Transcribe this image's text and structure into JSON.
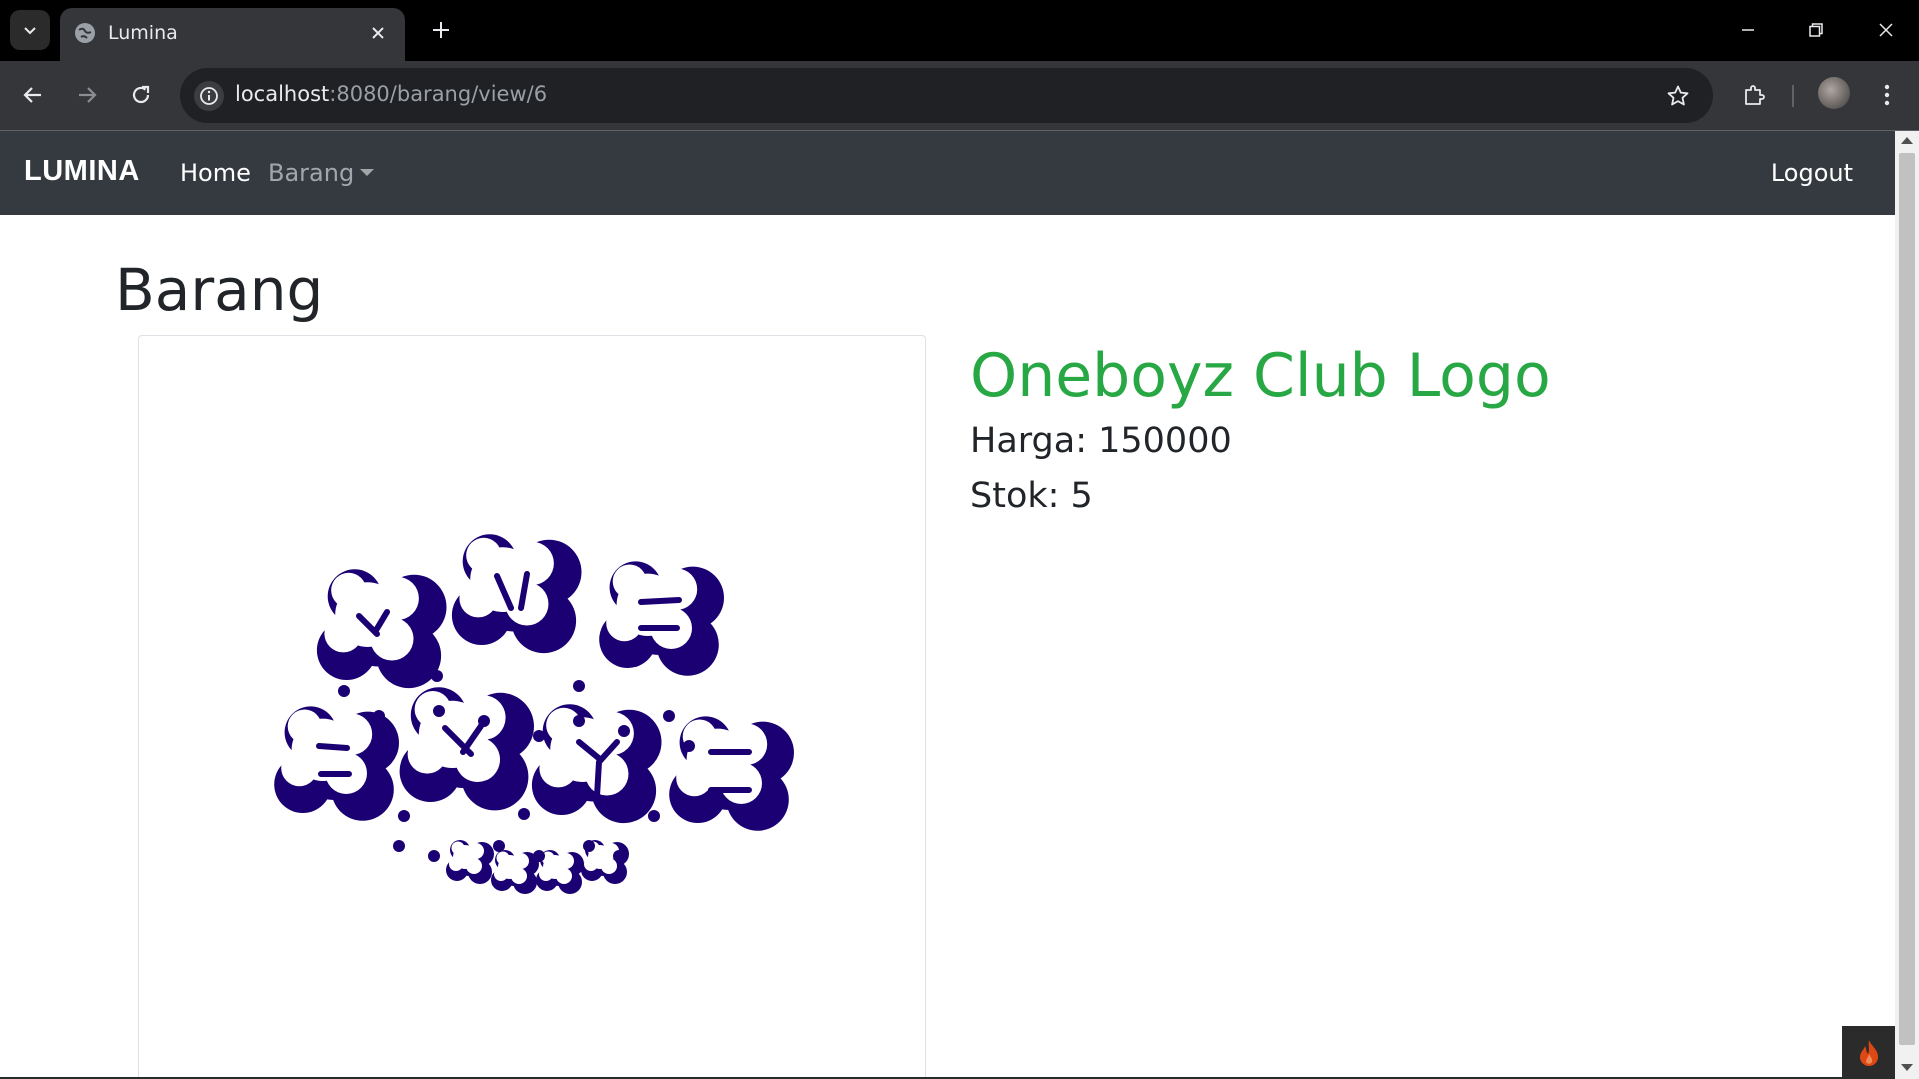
{
  "browser": {
    "tab_title": "Lumina",
    "url_host": "localhost",
    "url_path": ":8080/barang/view/6",
    "icons": {
      "tab_list": "chevron-down-icon",
      "tab_favicon": "globe-icon",
      "tab_close": "close-icon",
      "new_tab": "plus-icon",
      "back": "arrow-left-icon",
      "forward": "arrow-right-icon",
      "reload": "reload-icon",
      "site_info": "info-icon",
      "bookmark": "star-icon",
      "extensions": "puzzle-icon",
      "menu": "kebab-menu-icon"
    }
  },
  "navbar": {
    "brand": "LUMINA",
    "home": "Home",
    "barang": "Barang",
    "logout": "Logout"
  },
  "page": {
    "heading": "Barang"
  },
  "product": {
    "name": "Oneboyz Club Logo",
    "price_text": "Harga: 150000",
    "stock_text": "Stok: 5",
    "image_alt": "Oneboyz Club logo artwork"
  },
  "colors": {
    "navbar_bg": "#343a40",
    "product_name": "#28a745",
    "logo_fill": "#1a0073",
    "debug_flame": "#dd4814"
  }
}
